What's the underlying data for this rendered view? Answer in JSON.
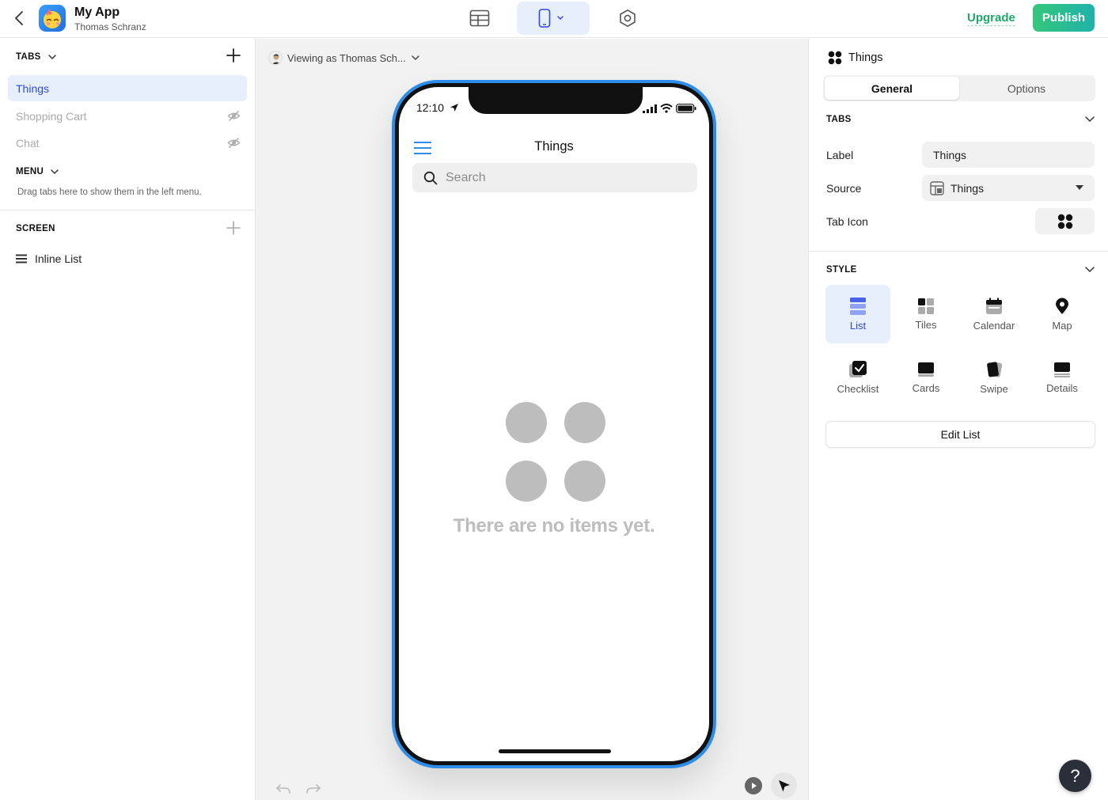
{
  "header": {
    "app_name": "My App",
    "owner": "Thomas Schranz",
    "upgrade_label": "Upgrade",
    "publish_label": "Publish"
  },
  "left_panel": {
    "tabs_heading": "TABS",
    "tabs": [
      {
        "label": "Things",
        "active": true,
        "hidden": false
      },
      {
        "label": "Shopping Cart",
        "active": false,
        "hidden": true
      },
      {
        "label": "Chat",
        "active": false,
        "hidden": true
      }
    ],
    "menu_heading": "MENU",
    "menu_hint": "Drag tabs here to show them in the left menu.",
    "screen_heading": "SCREEN",
    "screen_items": [
      {
        "label": "Inline List",
        "icon": "list-icon"
      }
    ]
  },
  "canvas": {
    "viewing_as": "Viewing as Thomas Sch...",
    "phone": {
      "time": "12:10",
      "screen_title": "Things",
      "search_placeholder": "Search",
      "empty_message": "There are no items yet."
    }
  },
  "right_panel": {
    "title": "Things",
    "segments": [
      {
        "label": "General",
        "active": true
      },
      {
        "label": "Options",
        "active": false
      }
    ],
    "tabs_heading": "TABS",
    "fields": {
      "label_label": "Label",
      "label_value": "Things",
      "source_label": "Source",
      "source_value": "Things",
      "tab_icon_label": "Tab Icon"
    },
    "style_heading": "STYLE",
    "style_options": [
      {
        "label": "List",
        "icon": "list-style-icon",
        "active": true
      },
      {
        "label": "Tiles",
        "icon": "tiles-icon",
        "active": false
      },
      {
        "label": "Calendar",
        "icon": "calendar-icon",
        "active": false
      },
      {
        "label": "Map",
        "icon": "map-pin-icon",
        "active": false
      },
      {
        "label": "Checklist",
        "icon": "checklist-icon",
        "active": false
      },
      {
        "label": "Cards",
        "icon": "cards-icon",
        "active": false
      },
      {
        "label": "Swipe",
        "icon": "swipe-icon",
        "active": false
      },
      {
        "label": "Details",
        "icon": "details-icon",
        "active": false
      }
    ],
    "edit_list_label": "Edit List",
    "help_label": "?"
  },
  "colors": {
    "accent_blue": "#2f4ad8",
    "active_bg": "#e7eefc",
    "upgrade_green": "#1fa66a",
    "phone_frame": "#2d8de8"
  }
}
